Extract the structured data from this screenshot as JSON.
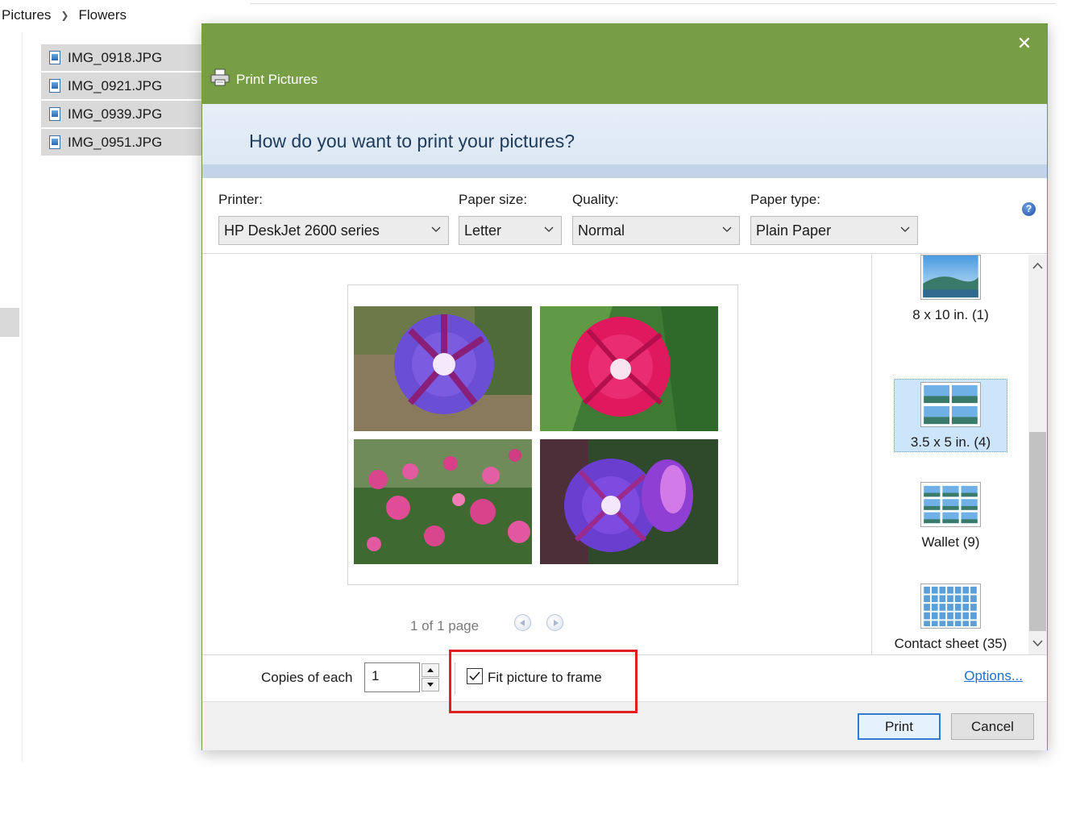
{
  "explorer": {
    "breadcrumb": [
      "Pictures",
      "Flowers"
    ],
    "files": [
      "IMG_0918.JPG",
      "IMG_0921.JPG",
      "IMG_0939.JPG",
      "IMG_0951.JPG"
    ]
  },
  "dialog": {
    "title": "Print Pictures",
    "close_icon": "close-icon",
    "question": "How do you want to print your pictures?",
    "printer_label": "Printer:",
    "printer_value": "HP DeskJet 2600 series",
    "paper_size_label": "Paper size:",
    "paper_size_value": "Letter",
    "quality_label": "Quality:",
    "quality_value": "Normal",
    "paper_type_label": "Paper type:",
    "paper_type_value": "Plain Paper",
    "page_info": "1 of 1 page",
    "layouts": [
      "8 x 10 in. (1)",
      "3.5 x 5 in. (4)",
      "Wallet (9)",
      "Contact sheet (35)"
    ],
    "selected_layout": "3.5 x 5 in. (4)",
    "copies_label": "Copies of each",
    "copies_value": "1",
    "fit_label": "Fit picture to frame",
    "fit_checked": true,
    "options_link": "Options...",
    "print_button": "Print",
    "cancel_button": "Cancel"
  },
  "colors": {
    "titlebar": "#789e45",
    "highlight": "#e02020",
    "link": "#1a6fd1",
    "selection": "#cde5fb"
  }
}
